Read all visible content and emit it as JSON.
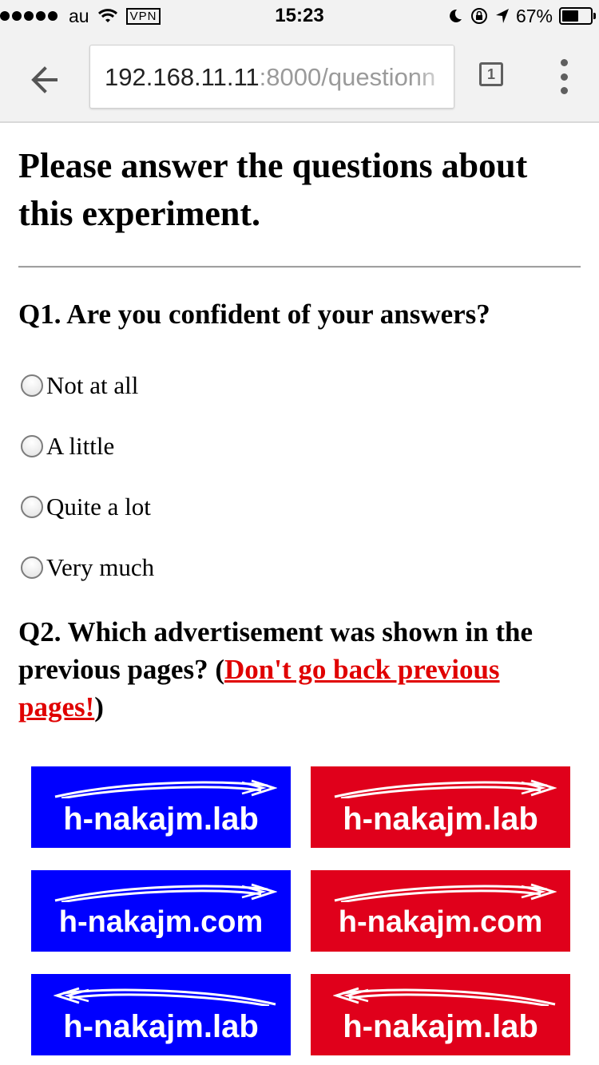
{
  "status_bar": {
    "carrier": "au",
    "vpn": "VPN",
    "time": "15:23",
    "battery_pct": "67%",
    "battery_level": 0.67
  },
  "browser": {
    "url_host": "192.168.11.11",
    "url_rest": ":8000/questionn",
    "tab_count": "1"
  },
  "page": {
    "title": "Please answer the questions about this experiment.",
    "q1": {
      "text": "Q1. Are you confident of your answers?",
      "options": [
        "Not at all",
        "A little",
        "Quite a lot",
        "Very much"
      ]
    },
    "q2": {
      "text_before": "Q2. Which advertisement was shown in the previous pages? (",
      "link_text": "Don't go back previous pages!",
      "text_after": ")"
    },
    "ads": [
      {
        "text": "h-nakajm.lab",
        "color": "#0000ff",
        "arrow": "right"
      },
      {
        "text": "h-nakajm.lab",
        "color": "#e0001b",
        "arrow": "right"
      },
      {
        "text": "h-nakajm.com",
        "color": "#0000ff",
        "arrow": "right"
      },
      {
        "text": "h-nakajm.com",
        "color": "#e0001b",
        "arrow": "right"
      },
      {
        "text": "h-nakajm.lab",
        "color": "#0000ff",
        "arrow": "left"
      },
      {
        "text": "h-nakajm.lab",
        "color": "#e0001b",
        "arrow": "left"
      }
    ]
  },
  "icons": {
    "signal": "signal-dots-icon",
    "wifi": "wifi-icon",
    "moon": "moon-icon",
    "rotation_lock": "rotation-lock-icon",
    "location": "location-arrow-icon",
    "back": "back-arrow-icon",
    "menu": "overflow-menu-icon"
  }
}
